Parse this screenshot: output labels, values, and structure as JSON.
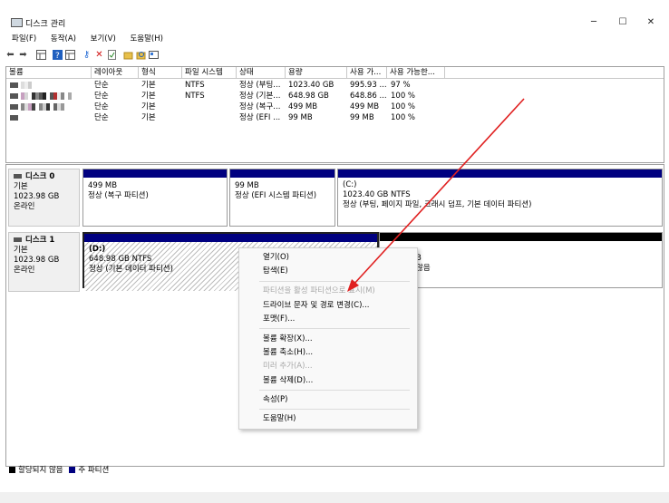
{
  "window": {
    "title": "디스크 관리",
    "minimize": "─",
    "maximize": "☐",
    "close": "✕"
  },
  "menu": [
    "파일(F)",
    "동작(A)",
    "보기(V)",
    "도움말(H)"
  ],
  "toolbar": [
    "back-icon",
    "forward-icon",
    "grid-icon",
    "help-icon",
    "grid2-icon",
    "key-icon",
    "delete-icon",
    "check-icon",
    "folder-icon",
    "search-icon",
    "properties-icon"
  ],
  "volume_list": {
    "headers": [
      "볼륨",
      "레이아웃",
      "형식",
      "파일 시스템",
      "상태",
      "용량",
      "사용 가...",
      "사용 가능한..."
    ],
    "rows": [
      {
        "layout": "단순",
        "type": "기본",
        "fs": "NTFS",
        "status": "정상 (부팅...",
        "capacity": "1023.40 GB",
        "free": "995.93 ...",
        "pct": "97 %"
      },
      {
        "layout": "단순",
        "type": "기본",
        "fs": "NTFS",
        "status": "정상 (기본...",
        "capacity": "648.98 GB",
        "free": "648.86 ...",
        "pct": "100 %"
      },
      {
        "layout": "단순",
        "type": "기본",
        "fs": "",
        "status": "정상 (복구...",
        "capacity": "499 MB",
        "free": "499 MB",
        "pct": "100 %"
      },
      {
        "layout": "단순",
        "type": "기본",
        "fs": "",
        "status": "정상 (EFI ...",
        "capacity": "99 MB",
        "free": "99 MB",
        "pct": "100 %"
      }
    ]
  },
  "disks": [
    {
      "name": "디스크 0",
      "type": "기본",
      "size": "1023.98 GB",
      "state": "온라인",
      "partitions": [
        {
          "title": "",
          "size": "499 MB",
          "status": "정상 (복구 파티션)"
        },
        {
          "title": "",
          "size": "99 MB",
          "status": "정상 (EFI 시스템 파티션)"
        },
        {
          "title": "(C:)",
          "size": "1023.40 GB NTFS",
          "status": "정상 (부팅, 페이지 파일, 크래시 덤프, 기본 데이터 파티션)"
        }
      ]
    },
    {
      "name": "디스크 1",
      "type": "기본",
      "size": "1023.98 GB",
      "state": "온라인",
      "partitions": [
        {
          "title": "(D:)",
          "size": "648.98 GB NTFS",
          "status": "정상 (기본 데이터 파티션)"
        },
        {
          "title": "",
          "size": "B",
          "status": "않음"
        }
      ]
    }
  ],
  "legend": {
    "unallocated": "할당되지 않음",
    "primary": "주 파티션"
  },
  "context_menu": [
    {
      "label": "열기(O)",
      "enabled": true
    },
    {
      "label": "탐색(E)",
      "enabled": true
    },
    {
      "label": "파티션을 활성 파티션으로 표시(M)",
      "enabled": false
    },
    {
      "label": "드라이브 문자 및 경로 변경(C)...",
      "enabled": true
    },
    {
      "label": "포맷(F)...",
      "enabled": true
    },
    {
      "label": "볼륨 확장(X)...",
      "enabled": true
    },
    {
      "label": "볼륨 축소(H)...",
      "enabled": true
    },
    {
      "label": "미러 추가(A)...",
      "enabled": false
    },
    {
      "label": "볼륨 삭제(D)...",
      "enabled": true
    },
    {
      "label": "속성(P)",
      "enabled": true
    },
    {
      "label": "도움말(H)",
      "enabled": true
    }
  ],
  "colors": {
    "primary_partition": "#000080",
    "unallocated": "#000000",
    "annotation_arrow": "#e02020"
  }
}
